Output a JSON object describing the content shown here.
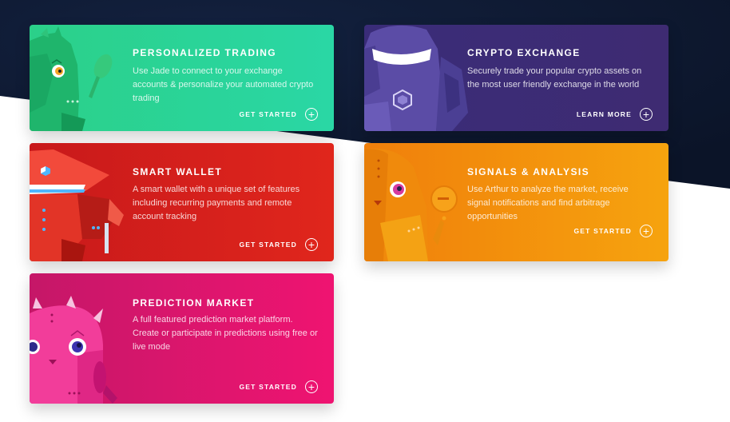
{
  "colors": {
    "navy_background": "#0f1a33",
    "trading_card": "#2ad29a",
    "exchange_card": "#3b2c76",
    "wallet_card": "#d41f1c",
    "signals_card": "#f4920d",
    "prediction_card": "#e0166e"
  },
  "cards": [
    {
      "title": "PERSONALIZED TRADING",
      "description": "Use Jade to connect to your exchange accounts & personalize your automated crypto trading",
      "cta": "GET STARTED",
      "icon": "green-robot-illustration"
    },
    {
      "title": "CRYPTO EXCHANGE",
      "description": "Securely trade your popular crypto assets on the most user friendly exchange in the world",
      "cta": "LEARN MORE",
      "icon": "purple-robot-illustration"
    },
    {
      "title": "SMART WALLET",
      "description": "A smart wallet with a unique set of features including recurring payments and remote account tracking",
      "cta": "GET STARTED",
      "icon": "red-robot-illustration"
    },
    {
      "title": "SIGNALS & ANALYSIS",
      "description": "Use Arthur to analyze the market, receive signal notifications and find arbitrage opportunities",
      "cta": "GET STARTED",
      "icon": "orange-robot-illustration"
    },
    {
      "title": "PREDICTION MARKET",
      "description": "A full featured prediction market platform. Create or participate in predictions using free or live mode",
      "cta": "GET STARTED",
      "icon": "pink-robot-illustration"
    }
  ]
}
